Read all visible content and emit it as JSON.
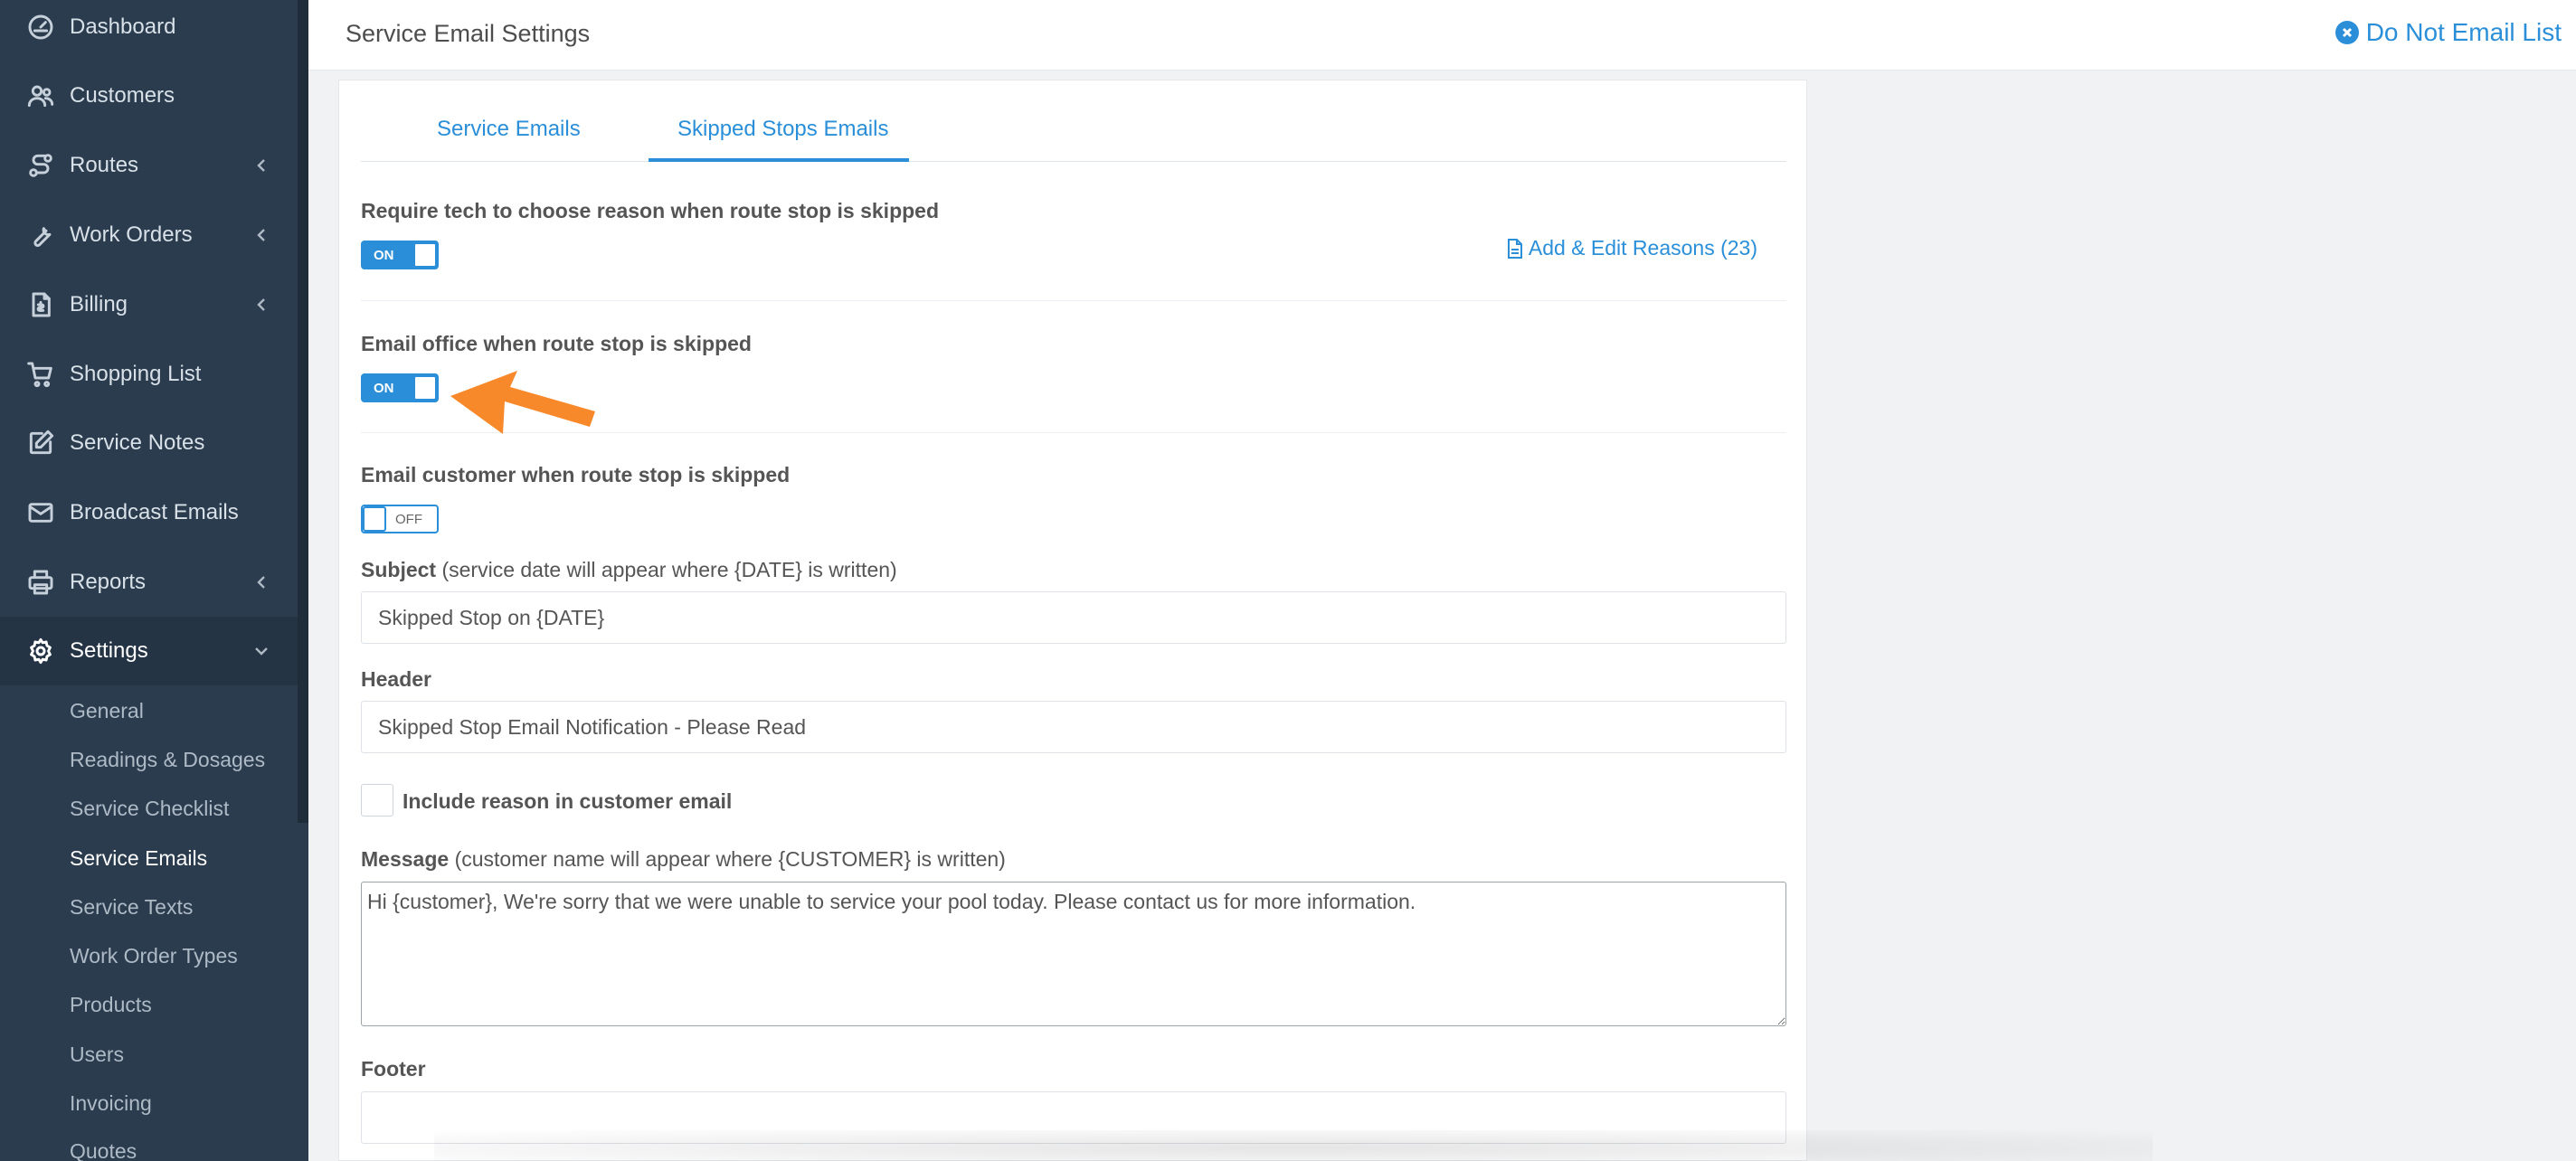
{
  "sidebar": {
    "nav": [
      {
        "label": "Dashboard",
        "icon": "dashboard-gauge-icon",
        "has_chevron": false
      },
      {
        "label": "Customers",
        "icon": "users-icon",
        "has_chevron": false
      },
      {
        "label": "Routes",
        "icon": "route-icon",
        "has_chevron": true
      },
      {
        "label": "Work Orders",
        "icon": "wrench-icon",
        "has_chevron": true
      },
      {
        "label": "Billing",
        "icon": "invoice-icon",
        "has_chevron": true
      },
      {
        "label": "Shopping List",
        "icon": "cart-icon",
        "has_chevron": false
      },
      {
        "label": "Service Notes",
        "icon": "edit-note-icon",
        "has_chevron": false
      },
      {
        "label": "Broadcast Emails",
        "icon": "envelope-icon",
        "has_chevron": false
      },
      {
        "label": "Reports",
        "icon": "printer-icon",
        "has_chevron": true
      },
      {
        "label": "Settings",
        "icon": "gear-icon",
        "has_chevron": true,
        "expanded": true
      }
    ],
    "settings_sub": [
      "General",
      "Readings & Dosages",
      "Service Checklist",
      "Service Emails",
      "Service Texts",
      "Work Order Types",
      "Products",
      "Users",
      "Invoicing",
      "Quotes"
    ],
    "active_sub": "Service Emails"
  },
  "header": {
    "title": "Service Email Settings",
    "do_not_email_label": "Do Not Email List"
  },
  "tabs": [
    {
      "label": "Service Emails",
      "active": false
    },
    {
      "label": "Skipped Stops Emails",
      "active": true
    }
  ],
  "form": {
    "require_reason": {
      "label": "Require tech to choose reason when route stop is skipped",
      "toggle_text": "ON",
      "state": "on"
    },
    "add_edit_reasons_label": "Add & Edit Reasons (23)",
    "email_office": {
      "label": "Email office when route stop is skipped",
      "toggle_text": "ON",
      "state": "on"
    },
    "email_customer": {
      "label": "Email customer when route stop is skipped",
      "toggle_text": "OFF",
      "state": "off"
    },
    "subject": {
      "label": "Subject",
      "hint": "(service date will appear where {DATE} is written)",
      "value": "Skipped Stop on {DATE}"
    },
    "header_field": {
      "label": "Header",
      "value": "Skipped Stop Email Notification - Please Read"
    },
    "include_reason_label": "Include reason in customer email",
    "message": {
      "label": "Message",
      "hint": "(customer name will appear where {CUSTOMER} is written)",
      "value": "Hi {customer}, We're sorry that we were unable to service your pool today. Please contact us for more information."
    },
    "footer": {
      "label": "Footer",
      "value": ""
    }
  },
  "colors": {
    "sidebar_bg": "#2b3c4e",
    "accent": "#2a8fd8",
    "annotation_arrow": "#f7892a"
  }
}
